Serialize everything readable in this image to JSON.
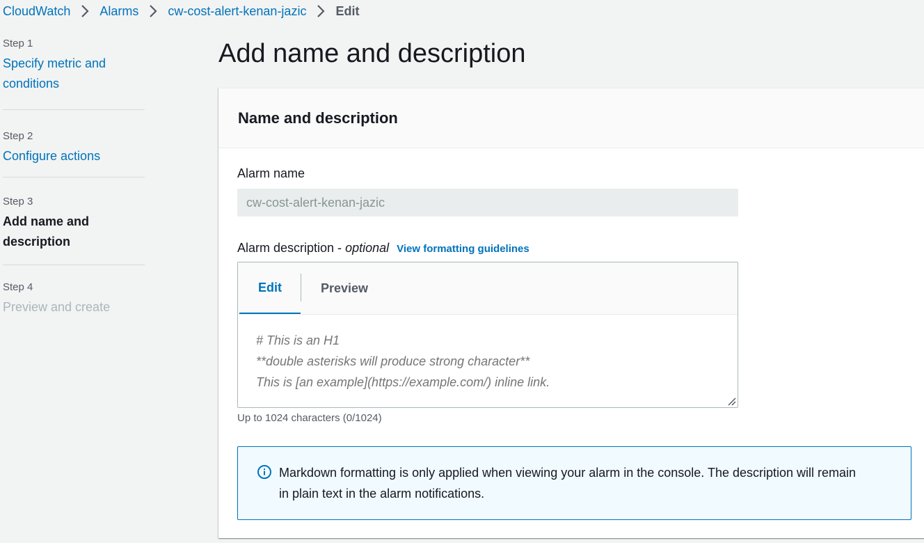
{
  "breadcrumb": {
    "items": [
      "CloudWatch",
      "Alarms",
      "cw-cost-alert-kenan-jazic"
    ],
    "current": "Edit",
    "separator_icon": "chevron-right-icon"
  },
  "steps": [
    {
      "num": "Step 1",
      "title": "Specify metric and conditions",
      "state": "link"
    },
    {
      "num": "Step 2",
      "title": "Configure actions",
      "state": "link"
    },
    {
      "num": "Step 3",
      "title": "Add name and description",
      "state": "active"
    },
    {
      "num": "Step 4",
      "title": "Preview and create",
      "state": "disabled"
    }
  ],
  "page": {
    "title": "Add name and description"
  },
  "section": {
    "title": "Name and description",
    "alarm_name": {
      "label": "Alarm name",
      "value": "cw-cost-alert-kenan-jazic"
    },
    "alarm_description": {
      "label": "Alarm description - ",
      "optional": "optional",
      "guidelines_link": "View formatting guidelines",
      "tabs": [
        "Edit",
        "Preview"
      ],
      "active_tab": "Edit",
      "placeholder_lines": [
        "# This is an H1",
        "**double asterisks will produce strong character**",
        "This is [an example](https://example.com/) inline link."
      ],
      "char_count": "Up to 1024 characters (0/1024)"
    },
    "info": {
      "icon": "info-circle-icon",
      "text": "Markdown formatting is only applied when viewing your alarm in the console. The description will remain in plain text in the alarm notifications."
    }
  },
  "colors": {
    "link": "#0073bb",
    "background": "#f2f3f3",
    "info_bg": "#f1faff"
  }
}
